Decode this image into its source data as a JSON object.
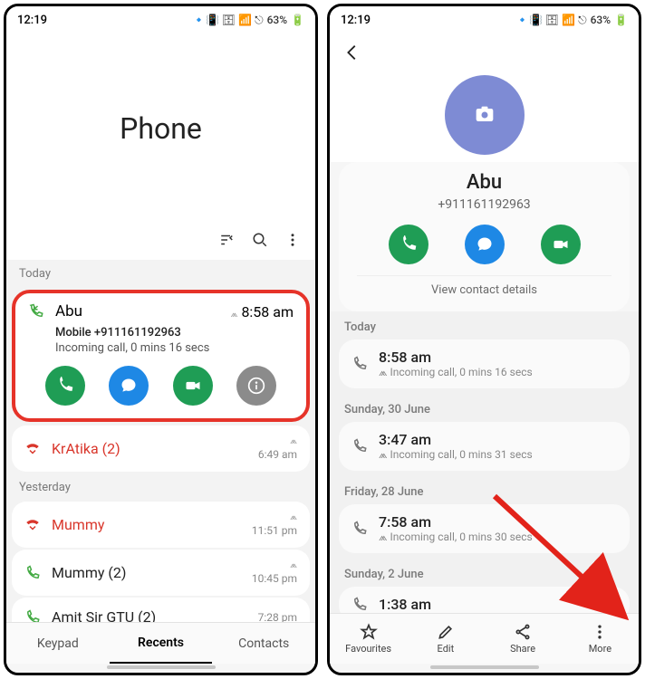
{
  "status": {
    "time": "12:19",
    "battery": "63%",
    "carrier": "Vo))"
  },
  "left": {
    "title": "Phone",
    "sections": {
      "today": "Today",
      "yesterday": "Yesterday"
    },
    "highlight": {
      "name": "Abu",
      "time": "8:58 am",
      "line1": "Mobile +911161192963",
      "line2": "Incoming call, 0 mins 16 secs"
    },
    "calls": [
      {
        "name": "KrAtika (2)",
        "time": "6:49 am",
        "type": "missed"
      },
      {
        "name": "Mummy",
        "time": "11:51 pm",
        "type": "missed"
      },
      {
        "name": "Mummy (2)",
        "time": "10:45 pm",
        "type": "incoming"
      },
      {
        "name": "Amit Sir GTU (2)",
        "time": "7:28 pm",
        "type": "incoming"
      }
    ],
    "tabs": {
      "keypad": "Keypad",
      "recents": "Recents",
      "contacts": "Contacts"
    }
  },
  "right": {
    "contact": {
      "name": "Abu",
      "number": "+911161192963",
      "view_link": "View contact details"
    },
    "history": [
      {
        "section": "Today",
        "time": "8:58 am",
        "detail": "Incoming call, 0 mins 16 secs"
      },
      {
        "section": "Sunday, 30 June",
        "time": "3:47 am",
        "detail": "Incoming call, 0 mins 31 secs"
      },
      {
        "section": "Friday, 28 June",
        "time": "7:58 am",
        "detail": "Incoming call, 0 mins 30 secs"
      },
      {
        "section": "Sunday, 2 June",
        "time": "1:38 am",
        "detail": ""
      }
    ],
    "tabs": {
      "fav": "Favourites",
      "edit": "Edit",
      "share": "Share",
      "more": "More"
    }
  }
}
